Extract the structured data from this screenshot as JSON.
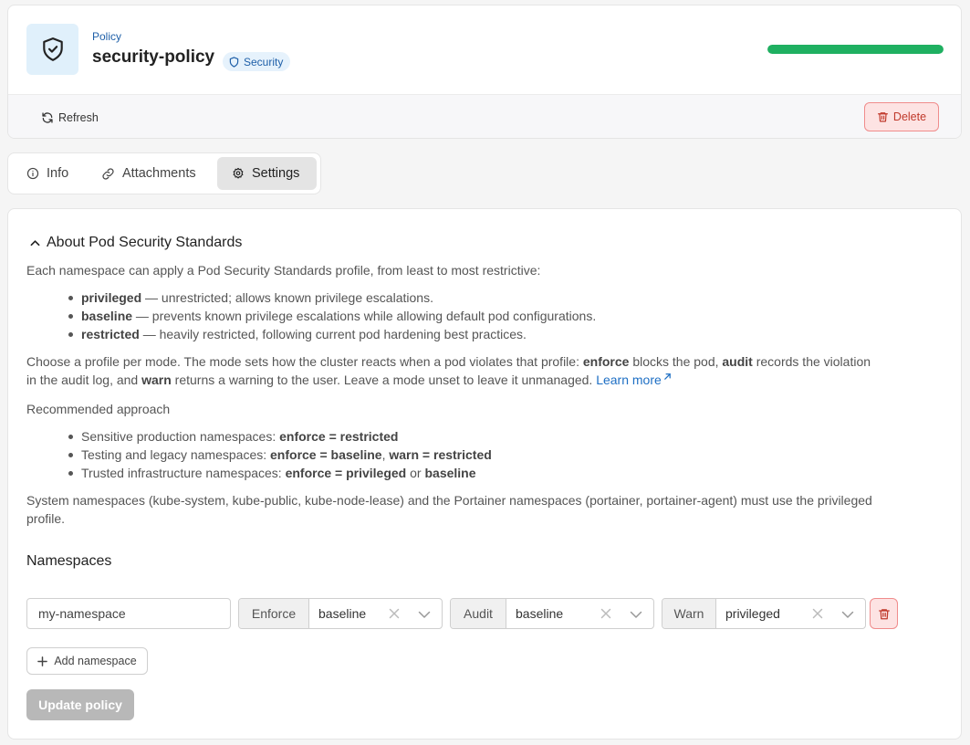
{
  "header": {
    "kind_label": "Policy",
    "policy_name": "security-policy",
    "type_badge": "Security",
    "progress_percent": 100,
    "progress_color": "#1fb061",
    "refresh_label": "Refresh",
    "delete_label": "Delete"
  },
  "tabs": [
    {
      "label": "Info",
      "icon": "info-icon",
      "active": false
    },
    {
      "label": "Attachments",
      "icon": "link-icon",
      "active": false
    },
    {
      "label": "Settings",
      "icon": "gear-icon",
      "active": true
    }
  ],
  "about": {
    "title": "About Pod Security Standards",
    "intro": "Each namespace can apply a Pod Security Standards profile, from least to most restrictive:",
    "profiles": [
      {
        "name": "privileged",
        "desc": " — unrestricted; allows known privilege escalations."
      },
      {
        "name": "baseline",
        "desc": " — prevents known privilege escalations while allowing default pod configurations."
      },
      {
        "name": "restricted",
        "desc": " — heavily restricted, following current pod hardening best practices."
      }
    ],
    "mode_text": {
      "p1": "Choose a profile per mode. The mode sets how the cluster reacts when a pod violates that profile: ",
      "enforce": "enforce",
      "p2": " blocks the pod, ",
      "audit": "audit",
      "p3": " records the violation",
      "p4": "in the audit log, and ",
      "warn": "warn",
      "p5": " returns a warning to the user. Leave a mode unset to leave it unmanaged. ",
      "learn_more": "Learn more"
    },
    "recommended_title": "Recommended approach",
    "recommendations": [
      {
        "prefix": "Sensitive production namespaces: ",
        "bold1": "enforce = restricted",
        "mid": "",
        "bold2": ""
      },
      {
        "prefix": "Testing and legacy namespaces: ",
        "bold1": "enforce = baseline",
        "mid": ", ",
        "bold2": "warn = restricted"
      },
      {
        "prefix": "Trusted infrastructure namespaces: ",
        "bold1": "enforce = privileged",
        "mid": " or ",
        "bold2": "baseline"
      }
    ],
    "system_note_1": "System namespaces (kube-system, kube-public, kube-node-lease) and the Portainer namespaces (portainer, portainer-agent) must use the privileged",
    "system_note_2": "profile."
  },
  "namespaces": {
    "title": "Namespaces",
    "rows": [
      {
        "name": "my-namespace",
        "enforce_label": "Enforce",
        "enforce_value": "baseline",
        "audit_label": "Audit",
        "audit_value": "baseline",
        "warn_label": "Warn",
        "warn_value": "privileged"
      }
    ],
    "add_label": "Add namespace",
    "update_label": "Update policy"
  }
}
